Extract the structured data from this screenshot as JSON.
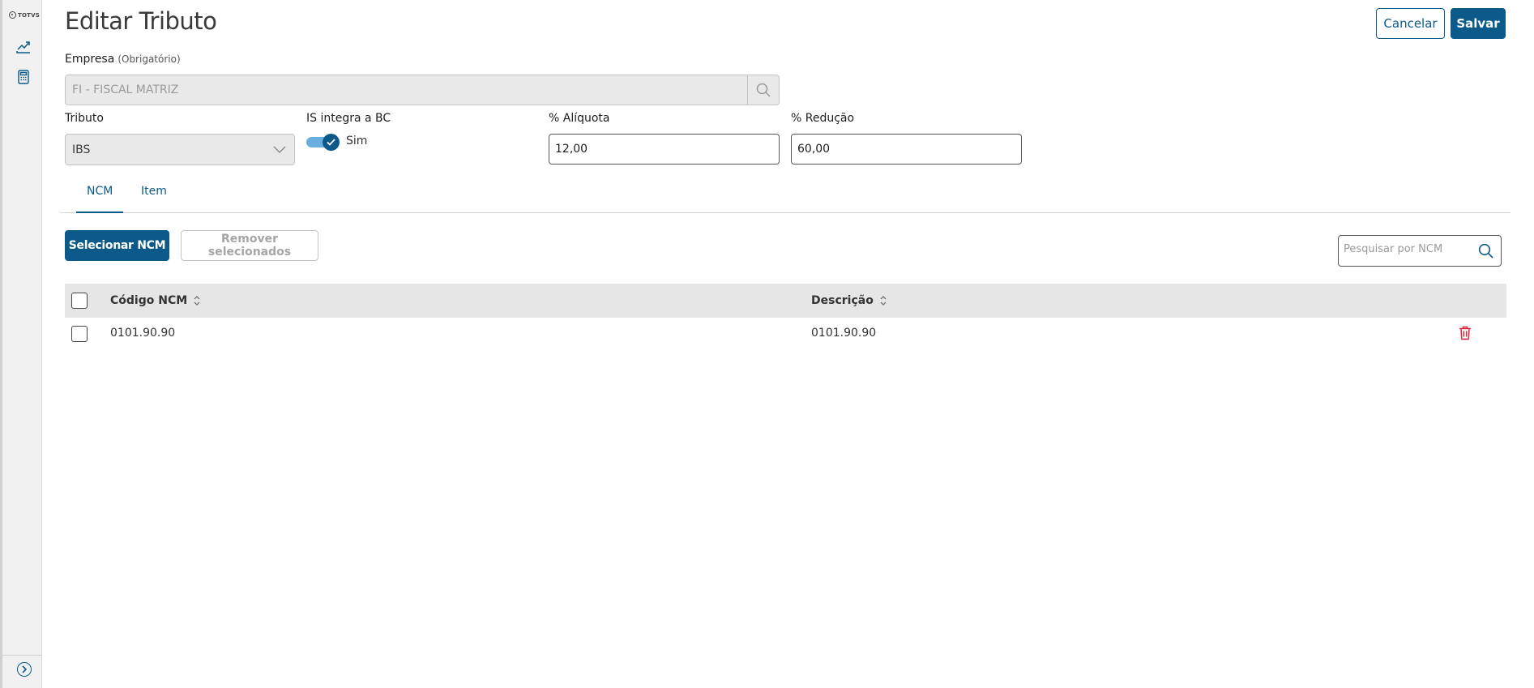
{
  "sidebar": {
    "logo_text": "TOTVS",
    "icons": [
      "chart-line-icon",
      "calculator-icon"
    ],
    "expand_icon": "chevron-right-circle-icon"
  },
  "header": {
    "title": "Editar Tributo",
    "cancel_label": "Cancelar",
    "save_label": "Salvar"
  },
  "form": {
    "empresa": {
      "label": "Empresa",
      "required_hint": "(Obrigatório)",
      "value": "FI - FISCAL MATRIZ"
    },
    "tributo": {
      "label": "Tributo",
      "value": "IBS"
    },
    "is_integra_bc": {
      "label": "IS integra a BC",
      "value_text": "Sim",
      "checked": true
    },
    "aliquota": {
      "label": "% Alíquota",
      "value": "12,00"
    },
    "reducao": {
      "label": "% Redução",
      "value": "60,00"
    }
  },
  "tabs": [
    {
      "label": "NCM",
      "active": true
    },
    {
      "label": "Item",
      "active": false
    }
  ],
  "toolbar": {
    "select_label": "Selecionar NCM",
    "remove_label": "Remover selecionados",
    "search_placeholder": "Pesquisar por NCM"
  },
  "table": {
    "columns": [
      "Código NCM",
      "Descrição"
    ],
    "rows": [
      {
        "codigo": "0101.90.90",
        "descricao": "0101.90.90"
      }
    ]
  },
  "colors": {
    "primary": "#0c5a8a",
    "danger": "#e0263a",
    "toggle_track": "#6aaee0"
  }
}
